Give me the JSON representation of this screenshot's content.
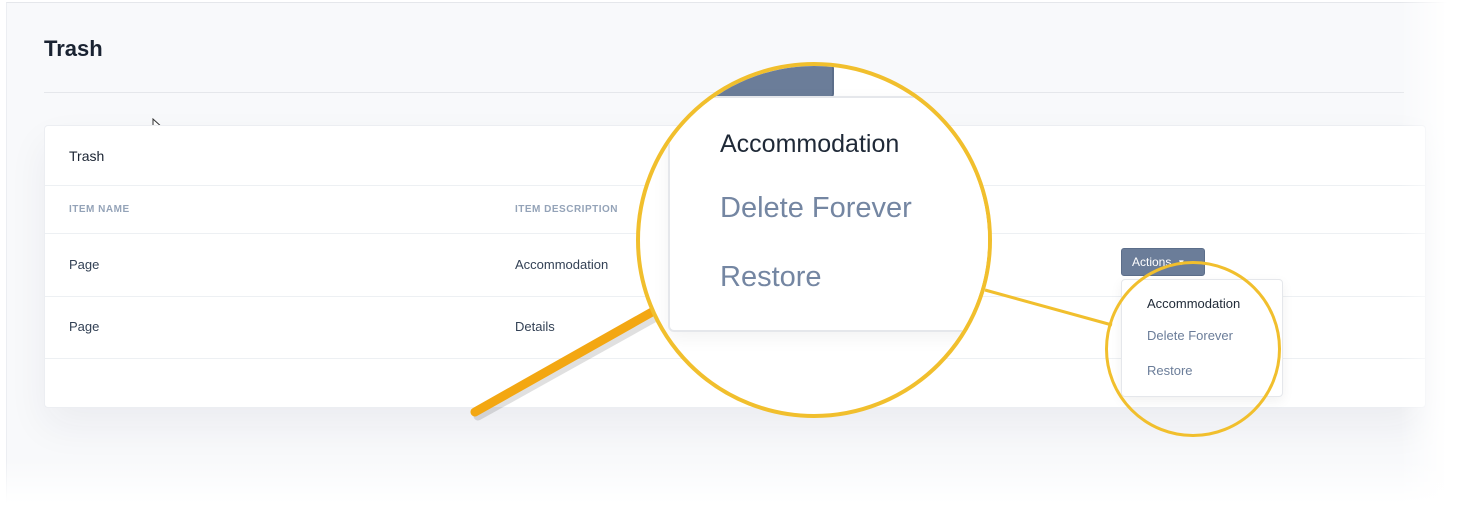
{
  "page": {
    "title": "Trash"
  },
  "card": {
    "title": "Trash"
  },
  "table": {
    "headers": [
      "ITEM NAME",
      "ITEM DESCRIPTION"
    ],
    "rows": [
      {
        "name": "Page",
        "description": "Accommodation"
      },
      {
        "name": "Page",
        "description": "Details"
      }
    ]
  },
  "actions": {
    "label": "Actions",
    "menu": [
      "Accommodation",
      "Delete Forever",
      "Restore"
    ]
  },
  "annotation": {
    "highlight_color": "#f1bf2d",
    "arrow_color": "#f3a712"
  },
  "colors": {
    "button": "#6b7d99",
    "muted_text": "#6b7d99",
    "primary_text": "#1f2937"
  }
}
